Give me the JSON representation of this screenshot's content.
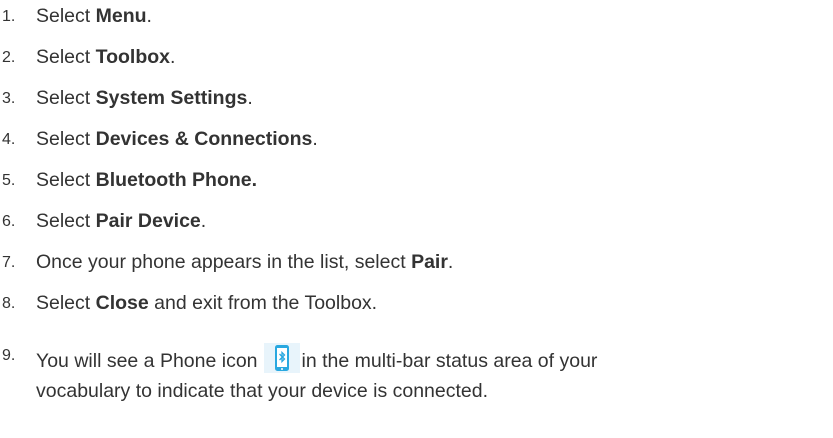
{
  "steps": [
    {
      "num": "1.",
      "pre": "Select ",
      "bold": "Menu",
      "post": "."
    },
    {
      "num": "2.",
      "pre": "Select ",
      "bold": "Toolbox",
      "post": "."
    },
    {
      "num": "3.",
      "pre": "Select ",
      "bold": "System Settings",
      "post": "."
    },
    {
      "num": "4.",
      "pre": "Select ",
      "bold": "Devices & Connections",
      "post": "."
    },
    {
      "num": "5.",
      "pre": "Select ",
      "bold": "Bluetooth Phone.",
      "post": ""
    },
    {
      "num": "6.",
      "pre": "Select ",
      "bold": "Pair Device",
      "post": "."
    },
    {
      "num": "7.",
      "pre": "Once your phone appears in the list, select ",
      "bold": "Pair",
      "post": "."
    },
    {
      "num": "8.",
      "pre": "Select ",
      "bold": "Close",
      "post": " and exit from the Toolbox."
    }
  ],
  "step9": {
    "num": "9.",
    "before_icon": "You will see a Phone icon",
    "after_icon": "in the multi-bar status area of your",
    "line2": "vocabulary to indicate that your device is connected."
  },
  "icons": {
    "phone_icon": "bluetooth-phone-icon",
    "phone_icon_color": "#29a8e0"
  }
}
